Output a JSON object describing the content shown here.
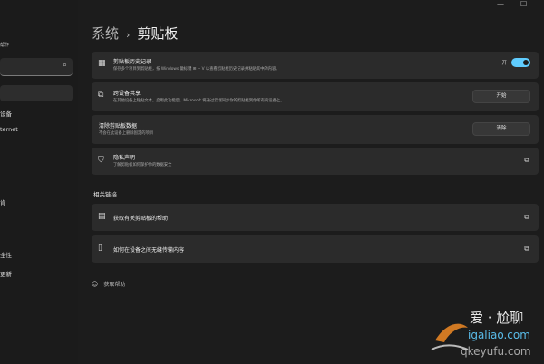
{
  "window": {
    "minimize_glyph": "—",
    "maximize_glyph": "☐"
  },
  "sidebar": {
    "user_fragment": "帮作",
    "search_icon": "search-icon",
    "items": [
      {
        "label": "设备"
      },
      {
        "label": "ternet"
      },
      {
        "label": "肯"
      },
      {
        "label": "全性"
      },
      {
        "label": "更新"
      }
    ]
  },
  "header": {
    "crumb": "系统",
    "separator": "›",
    "title": "剪贴板"
  },
  "cards": {
    "history": {
      "icon": "clipboard-history-icon",
      "title": "剪贴板历史记录",
      "desc": "保存多个项目到剪贴板，按 Windows 徽标键 ⊞ + V 以查看剪贴板历史记录并粘贴其中的内容。",
      "toggle_label": "开",
      "toggle_state": "on"
    },
    "sync": {
      "icon": "cross-device-icon",
      "title": "跨设备共享",
      "desc": "在其他设备上粘贴文本。启用此功能后，Microsoft 将通过云端同步你的剪贴板到你所有的设备上。",
      "button": "开始"
    },
    "clear": {
      "title": "清除剪贴板数据",
      "desc": "不会在此设备上删除固定的项目",
      "button": "清除"
    },
    "privacy": {
      "icon": "shield-icon",
      "title": "隐私声明",
      "desc": "了解剪贴板如何保护你的数据安全"
    }
  },
  "related": {
    "heading": "相关链接",
    "links": [
      {
        "icon": "help-doc-icon",
        "label": "获取有关剪贴板的帮助"
      },
      {
        "icon": "phone-icon",
        "label": "如何在设备之间无缝传输内容"
      }
    ]
  },
  "help": {
    "label": "获取帮助"
  },
  "watermark": {
    "brand": "爱 · 尬聊",
    "site": "igaliao.com",
    "sub": "qkeyufu.com"
  },
  "colors": {
    "accent": "#60cdff",
    "card": "#2b2b2b",
    "background": "#1c1c1c"
  }
}
